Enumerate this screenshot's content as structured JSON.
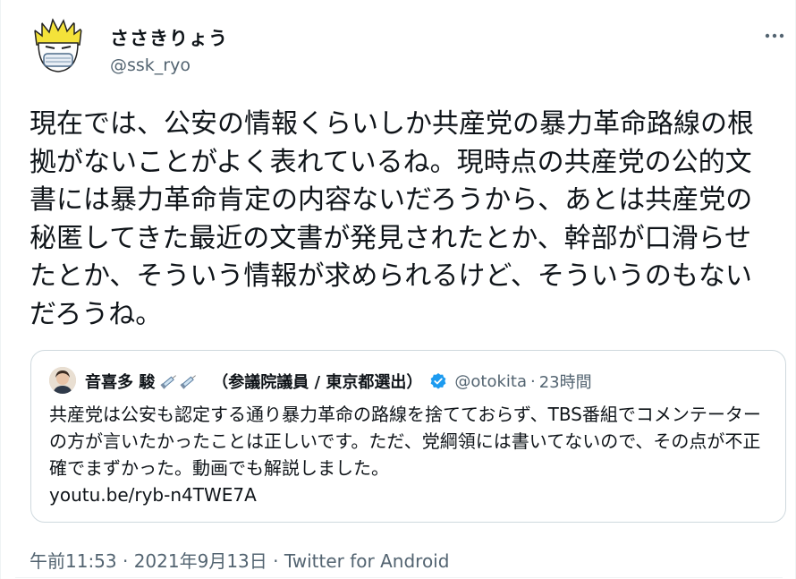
{
  "author": {
    "display_name": "ささきりょう",
    "handle": "@ssk_ryo"
  },
  "tweet": {
    "text": "現在では、公安の情報くらいしか共産党の暴力革命路線の根拠がないことがよく表れているね。現時点の共産党の公的文書には暴力革命肯定の内容ないだろうから、あとは共産党の秘匿してきた最近の文書が発見されたとか、幹部が口滑らせたとか、そういう情報が求められるけど、そういうのもないだろうね。"
  },
  "quoted_tweet": {
    "name": "音喜多 駿",
    "affiliation": "（参議院議員 / 東京都選出）",
    "handle": "@otokita",
    "separator": "·",
    "time": "23時間",
    "text": "共産党は公安も認定する通り暴力革命の路線を捨てておらず、TBS番組でコメンテーターの方が言いたかったことは正しいです。ただ、党綱領には書いてないので、その点が不正確でまずかった。動画でも解説しました。",
    "link": "youtu.be/ryb-n4TWE7A"
  },
  "meta": {
    "timestamp": "午前11:53 · 2021年9月13日 · ",
    "source": "Twitter for Android"
  },
  "icons": {
    "more": "more-horizontal-icon",
    "verified": "verified-badge-icon",
    "syringe": "syringe-emoji-icon"
  },
  "colors": {
    "text_primary": "#0f1419",
    "text_secondary": "#536471",
    "border": "#cfd9de",
    "verified": "#1d9bf0"
  }
}
